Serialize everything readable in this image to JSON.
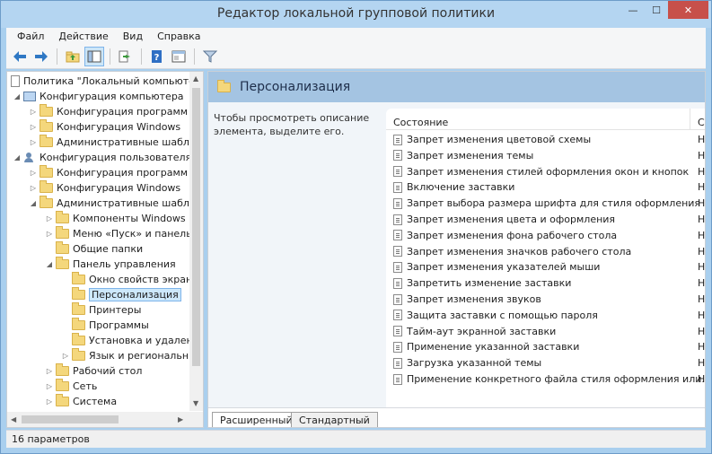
{
  "window": {
    "title": "Редактор локальной групповой политики",
    "minimize": "—",
    "maximize": "☐",
    "close": "✕"
  },
  "menu": [
    "Файл",
    "Действие",
    "Вид",
    "Справка"
  ],
  "toolbar": {
    "buttons": [
      "back-icon",
      "forward-icon",
      "up-folder-icon",
      "show-tree-icon",
      "export-icon",
      "help-icon",
      "properties-icon",
      "filter-icon"
    ]
  },
  "tree": {
    "root": "Политика \"Локальный компьютер\"",
    "computer_config": "Конфигурация компьютера",
    "cc_programs": "Конфигурация программ",
    "cc_windows": "Конфигурация Windows",
    "cc_admin": "Административные шаблоны",
    "user_config": "Конфигурация пользователя",
    "uc_programs": "Конфигурация программ",
    "uc_windows": "Конфигурация Windows",
    "uc_admin": "Административные шаблоны",
    "win_components": "Компоненты Windows",
    "start_menu": "Меню «Пуск» и панель задач",
    "shared_folders": "Общие папки",
    "control_panel": "Панель управления",
    "display_props": "Окно свойств экрана",
    "personalization": "Персонализация",
    "printers": "Принтеры",
    "programs": "Программы",
    "add_remove": "Установка и удаление",
    "region_lang": "Язык и региональные",
    "desktop": "Рабочий стол",
    "network": "Сеть",
    "system": "Система"
  },
  "right": {
    "header": "Персонализация",
    "description": "Чтобы просмотреть описание элемента, выделите его.",
    "col_state": "Состояние",
    "col_other": "С",
    "rows": [
      {
        "name": "Запрет изменения цветовой схемы",
        "state": "Н"
      },
      {
        "name": "Запрет изменения темы",
        "state": "Н"
      },
      {
        "name": "Запрет изменения стилей оформления окон и кнопок",
        "state": "Н"
      },
      {
        "name": "Включение заставки",
        "state": "Н"
      },
      {
        "name": "Запрет выбора размера шрифта для стиля оформления",
        "state": "Н"
      },
      {
        "name": "Запрет изменения цвета и оформления",
        "state": "Н"
      },
      {
        "name": "Запрет изменения фона рабочего стола",
        "state": "Н"
      },
      {
        "name": "Запрет изменения значков рабочего стола",
        "state": "Н"
      },
      {
        "name": "Запрет изменения указателей мыши",
        "state": "Н"
      },
      {
        "name": "Запретить изменение заставки",
        "state": "Н"
      },
      {
        "name": "Запрет изменения звуков",
        "state": "Н"
      },
      {
        "name": "Защита заставки с помощью пароля",
        "state": "Н"
      },
      {
        "name": "Тайм-аут экранной заставки",
        "state": "Н"
      },
      {
        "name": "Применение указанной заставки",
        "state": "Н"
      },
      {
        "name": "Загрузка указанной темы",
        "state": "Н"
      },
      {
        "name": "Применение конкретного файла стиля оформления или...",
        "state": "Н"
      }
    ],
    "tab_extended": "Расширенный",
    "tab_standard": "Стандартный"
  },
  "status": "16 параметров"
}
